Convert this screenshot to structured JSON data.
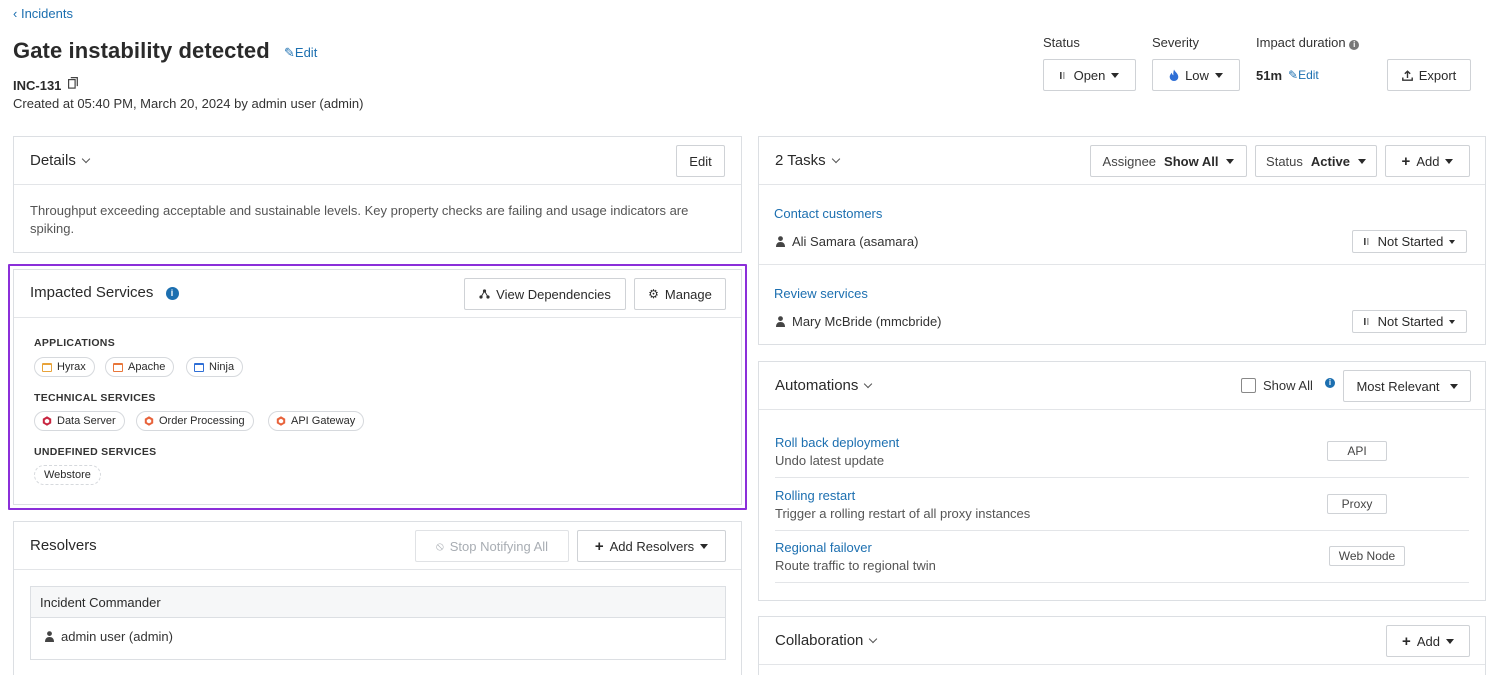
{
  "breadcrumb": {
    "label": "Incidents"
  },
  "incident": {
    "title": "Gate instability detected",
    "edit_label": "Edit",
    "id": "INC-131",
    "created": "Created at 05:40 PM, March 20, 2024 by admin user (admin)"
  },
  "header": {
    "status_label": "Status",
    "status_value": "Open",
    "severity_label": "Severity",
    "severity_value": "Low",
    "impact_label": "Impact duration",
    "impact_value": "51m",
    "impact_edit": "Edit",
    "export_label": "Export"
  },
  "details": {
    "title": "Details",
    "edit_label": "Edit",
    "description": "Throughput exceeding acceptable and sustainable levels. Key property checks are failing and usage indicators are spiking."
  },
  "impacted": {
    "title": "Impacted Services",
    "view_deps_label": "View Dependencies",
    "manage_label": "Manage",
    "applications_label": "APPLICATIONS",
    "applications": [
      "Hyrax",
      "Apache",
      "Ninja"
    ],
    "technical_label": "TECHNICAL SERVICES",
    "technical": [
      "Data Server",
      "Order Processing",
      "API Gateway"
    ],
    "undefined_label": "UNDEFINED SERVICES",
    "undefined": [
      "Webstore"
    ]
  },
  "resolvers": {
    "title": "Resolvers",
    "stop_label": "Stop Notifying All",
    "add_label": "Add Resolvers",
    "role": "Incident Commander",
    "user": "admin user (admin)"
  },
  "tasks": {
    "title": "2 Tasks",
    "assignee_label": "Assignee",
    "assignee_value": "Show All",
    "status_label": "Status",
    "status_value": "Active",
    "add_label": "Add",
    "items": [
      {
        "name": "Contact customers",
        "owner": "Ali Samara (asamara)",
        "state": "Not Started"
      },
      {
        "name": "Review services",
        "owner": "Mary McBride (mmcbride)",
        "state": "Not Started"
      }
    ]
  },
  "automations": {
    "title": "Automations",
    "show_all_label": "Show All",
    "sort_label": "Most Relevant",
    "items": [
      {
        "name": "Roll back deployment",
        "desc": "Undo latest update",
        "tag": "API"
      },
      {
        "name": "Rolling restart",
        "desc": "Trigger a rolling restart of all proxy instances",
        "tag": "Proxy"
      },
      {
        "name": "Regional failover",
        "desc": "Route traffic to regional twin",
        "tag": "Web Node"
      }
    ]
  },
  "collaboration": {
    "title": "Collaboration",
    "add_label": "Add"
  },
  "colors": {
    "link": "#1c6fb0",
    "highlight": "#8b2fd9",
    "app_yellow": "#e8a33a",
    "app_orange": "#e8763a",
    "app_blue": "#2f6fd6",
    "tech_red": "#c8253f",
    "tech_orange": "#e8623a"
  }
}
